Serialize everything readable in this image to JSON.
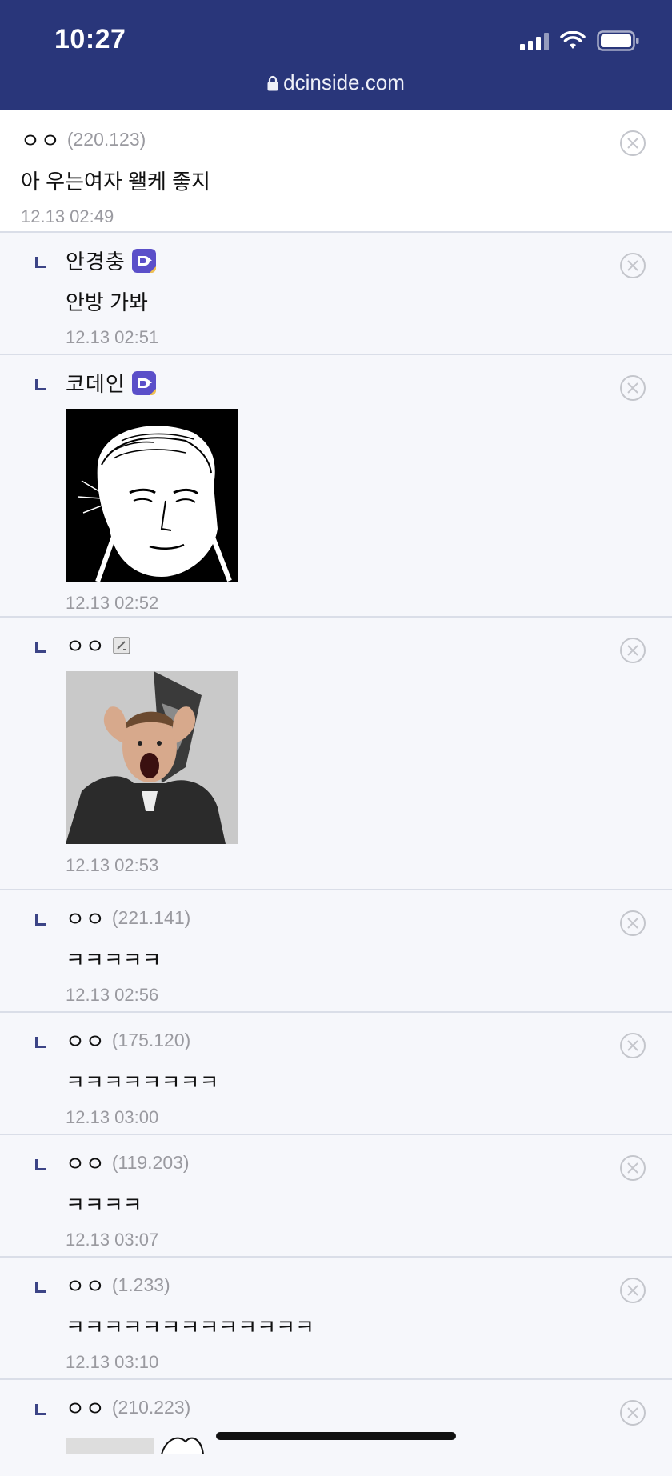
{
  "status": {
    "time": "10:27"
  },
  "browser": {
    "url": "dcinside.com"
  },
  "comments": [
    {
      "nick": "ㅇㅇ",
      "ip": "(220.123)",
      "text": "아 우는여자 왤케 좋지",
      "date": "12.13 02:49"
    },
    {
      "nick": "안경충",
      "text": "안방 가봐",
      "date": "12.13 02:51",
      "badge": "gallery-manager-badge-icon"
    },
    {
      "nick": "코데인",
      "date": "12.13 02:52",
      "badge": "gallery-manager-badge-icon",
      "image": "manga-face-sticker"
    },
    {
      "nick": "ㅇㅇ",
      "date": "12.13 02:53",
      "badge": "memo-icon",
      "image": "surprised-man-gif"
    },
    {
      "nick": "ㅇㅇ",
      "ip": "(221.141)",
      "text": "ㅋㅋㅋㅋㅋ",
      "date": "12.13 02:56"
    },
    {
      "nick": "ㅇㅇ",
      "ip": "(175.120)",
      "text": "ㅋㅋㅋㅋㅋㅋㅋㅋ",
      "date": "12.13 03:00"
    },
    {
      "nick": "ㅇㅇ",
      "ip": "(119.203)",
      "text": "ㅋㅋㅋㅋ",
      "date": "12.13 03:07"
    },
    {
      "nick": "ㅇㅇ",
      "ip": "(1.233)",
      "text": "ㅋㅋㅋㅋㅋㅋㅋㅋㅋㅋㅋㅋㅋ",
      "date": "12.13 03:10"
    },
    {
      "nick": "ㅇㅇ",
      "ip": "(210.223)"
    }
  ],
  "colors": {
    "header_bg": "#29367a",
    "reply_mark": "#3c4486",
    "meta_text": "#9a9aa0"
  }
}
